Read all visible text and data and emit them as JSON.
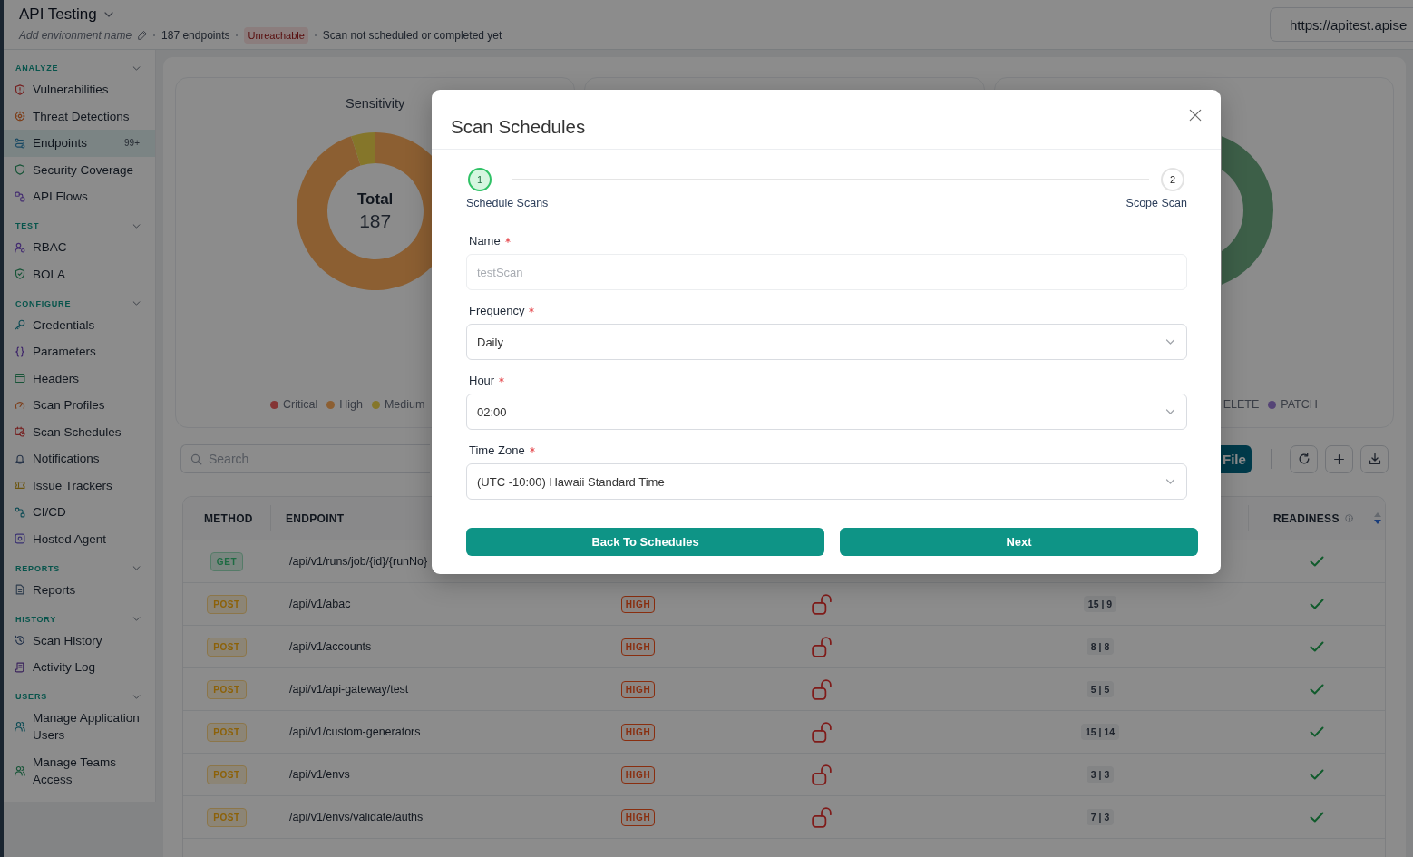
{
  "header": {
    "title": "API Testing",
    "environment_prompt": "Add environment name",
    "endpoint_count": "187 endpoints",
    "status_badge": "Unreachable",
    "scan_status": "Scan not scheduled or completed yet",
    "url": "https://apitest.apise"
  },
  "sidebar": {
    "groups": [
      {
        "title": "ANALYZE",
        "expanded": true,
        "items": [
          {
            "label": "Vulnerabilities",
            "selected": false
          },
          {
            "label": "Threat Detections",
            "selected": false
          },
          {
            "label": "Endpoints",
            "selected": true,
            "badge": "99+"
          },
          {
            "label": "Security Coverage",
            "selected": false
          },
          {
            "label": "API Flows",
            "selected": false
          }
        ]
      },
      {
        "title": "TEST",
        "expanded": true,
        "items": [
          {
            "label": "RBAC",
            "selected": false
          },
          {
            "label": "BOLA",
            "selected": false
          }
        ]
      },
      {
        "title": "CONFIGURE",
        "expanded": true,
        "items": [
          {
            "label": "Credentials",
            "selected": false
          },
          {
            "label": "Parameters",
            "selected": false
          },
          {
            "label": "Headers",
            "selected": false
          },
          {
            "label": "Scan Profiles",
            "selected": false
          },
          {
            "label": "Scan Schedules",
            "selected": false
          },
          {
            "label": "Notifications",
            "selected": false
          },
          {
            "label": "Issue Trackers",
            "selected": false
          },
          {
            "label": "CI/CD",
            "selected": false
          },
          {
            "label": "Hosted Agent",
            "selected": false
          }
        ]
      },
      {
        "title": "REPORTS",
        "expanded": true,
        "items": [
          {
            "label": "Reports",
            "selected": false
          }
        ]
      },
      {
        "title": "HISTORY",
        "expanded": true,
        "items": [
          {
            "label": "Scan History",
            "selected": false
          },
          {
            "label": "Activity Log",
            "selected": false
          }
        ]
      },
      {
        "title": "USERS",
        "expanded": true,
        "items": [
          {
            "label": "Manage Application Users",
            "selected": false
          },
          {
            "label": "Manage Teams Access",
            "selected": false
          }
        ]
      }
    ]
  },
  "overview": {
    "sensitivity_card": {
      "center_label": "Total",
      "center_value": "187",
      "chart_data": {
        "type": "donut",
        "title": "Sensitivity",
        "categories": [
          "Critical",
          "High",
          "Medium"
        ],
        "values": [
          0,
          95,
          5
        ],
        "colors": [
          "#f06262",
          "#ffae5c",
          "#f2d84e"
        ]
      }
    },
    "method_card": {
      "legend": [
        {
          "label": "ELETE"
        },
        {
          "label": "PATCH",
          "color": "#564476"
        }
      ]
    }
  },
  "toolbar": {
    "search": {
      "placeholder": "Search"
    },
    "file_button": "File"
  },
  "table": {
    "columns": [
      {
        "label": "METHOD"
      },
      {
        "label": "ENDPOINT"
      },
      {
        "label": "READINESS",
        "sorted": true
      }
    ],
    "rows": [
      {
        "method": "GET",
        "color": "#7a8780",
        "endpoint": "/api/v1/runs/job/{id}/{runNo}",
        "ready": true
      },
      {
        "method": "POST",
        "color": "#8c8576",
        "endpoint": "/api/v1/abac",
        "column_3": "HIGH",
        "locked": false,
        "column_5": "15 | 9",
        "ready": true
      },
      {
        "method": "POST",
        "color": "#8c8576",
        "endpoint": "/api/v1/accounts",
        "column_3": "HIGH",
        "locked": false,
        "column_5": "8 | 8",
        "ready": true
      },
      {
        "method": "POST",
        "color": "#8c8576",
        "endpoint": "/api/v1/api-gateway/test",
        "column_3": "HIGH",
        "locked": false,
        "column_5": "5 | 5",
        "ready": true
      },
      {
        "method": "POST",
        "color": "#8c8576",
        "endpoint": "/api/v1/custom-generators",
        "column_3": "HIGH",
        "locked": false,
        "column_5": "15 | 14",
        "ready": true
      },
      {
        "method": "POST",
        "color": "#8c8576",
        "endpoint": "/api/v1/envs",
        "column_3": "HIGH",
        "locked": false,
        "column_5": "3 | 3",
        "ready": true
      },
      {
        "method": "POST",
        "color": "#8c8576",
        "endpoint": "/api/v1/envs/validate/auths",
        "column_3": "HIGH",
        "locked": false,
        "column_5": "7 | 3",
        "ready": true
      }
    ]
  },
  "modal": {
    "title": "Scan Schedules",
    "steps": [
      {
        "number": "1",
        "label": "Schedule Scans",
        "selected": true
      },
      {
        "number": "2",
        "label": "Scope Scan",
        "selected": false
      }
    ],
    "fields": [
      {
        "kind": "text",
        "label": "Name",
        "required": true,
        "placeholder": "testScan"
      },
      {
        "kind": "select",
        "label": "Frequency",
        "required": true,
        "value": "Daily"
      },
      {
        "kind": "select",
        "label": "Hour",
        "required": true,
        "value": "02:00"
      },
      {
        "kind": "select",
        "label": "Time Zone",
        "required": true,
        "value": "(UTC -10:00) Hawaii Standard Time"
      }
    ],
    "buttons": [
      "Back To Schedules",
      "Next"
    ]
  }
}
